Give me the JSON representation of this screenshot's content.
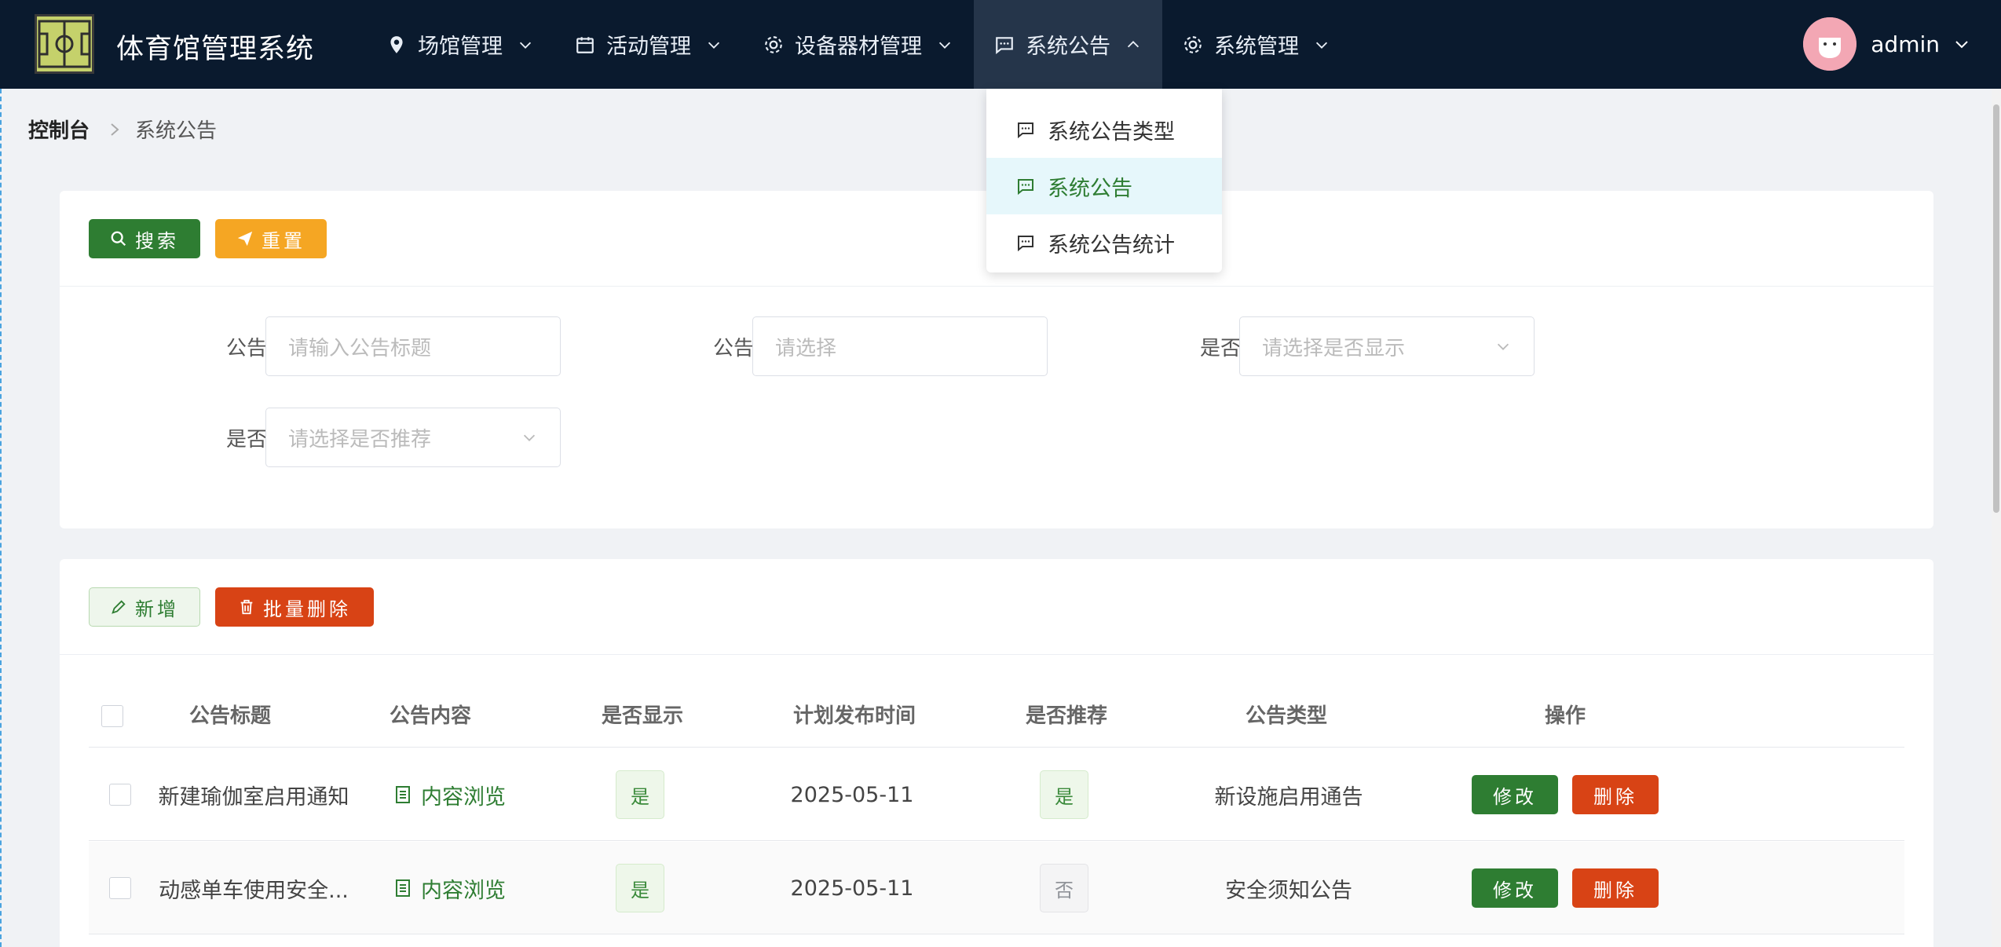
{
  "app": {
    "title": "体育馆管理系统"
  },
  "nav": {
    "items": [
      {
        "label": "场馆管理"
      },
      {
        "label": "活动管理"
      },
      {
        "label": "设备器材管理"
      },
      {
        "label": "系统公告"
      },
      {
        "label": "系统管理"
      }
    ],
    "active_index": 3
  },
  "user": {
    "name": "admin"
  },
  "dropdown": {
    "items": [
      {
        "label": "系统公告类型"
      },
      {
        "label": "系统公告"
      },
      {
        "label": "系统公告统计"
      }
    ],
    "active_index": 1
  },
  "breadcrumb": {
    "home": "控制台",
    "current": "系统公告"
  },
  "search_card": {
    "search_label": "搜索",
    "reset_label": "重置",
    "fields": {
      "title": {
        "label": "公告标题",
        "placeholder": "请输入公告标题"
      },
      "type": {
        "label": "公告类型",
        "placeholder": "请选择"
      },
      "show": {
        "label": "是否显示",
        "placeholder": "请选择是否显示"
      },
      "recommend": {
        "label": "是否推荐",
        "placeholder": "请选择是否推荐"
      }
    }
  },
  "table_card": {
    "add_label": "新增",
    "batch_delete_label": "批量删除",
    "columns": [
      "公告标题",
      "公告内容",
      "是否显示",
      "计划发布时间",
      "是否推荐",
      "公告类型",
      "操作"
    ],
    "rows": [
      {
        "title": "新建瑜伽室启用通知",
        "content": "内容浏览",
        "show": "是",
        "publish_time": "2025-05-11",
        "recommend": "是",
        "type": "新设施启用通告",
        "edit": "修改",
        "delete": "删除"
      },
      {
        "title": "动感单车使用安全...",
        "content": "内容浏览",
        "show": "是",
        "publish_time": "2025-05-11",
        "recommend": "否",
        "type": "安全须知公告",
        "edit": "修改",
        "delete": "删除"
      }
    ]
  },
  "colors": {
    "nav_bg": "#0a1a2e",
    "primary_green": "#2e7d32",
    "warning_orange": "#f5a623",
    "danger_red": "#d84315"
  }
}
